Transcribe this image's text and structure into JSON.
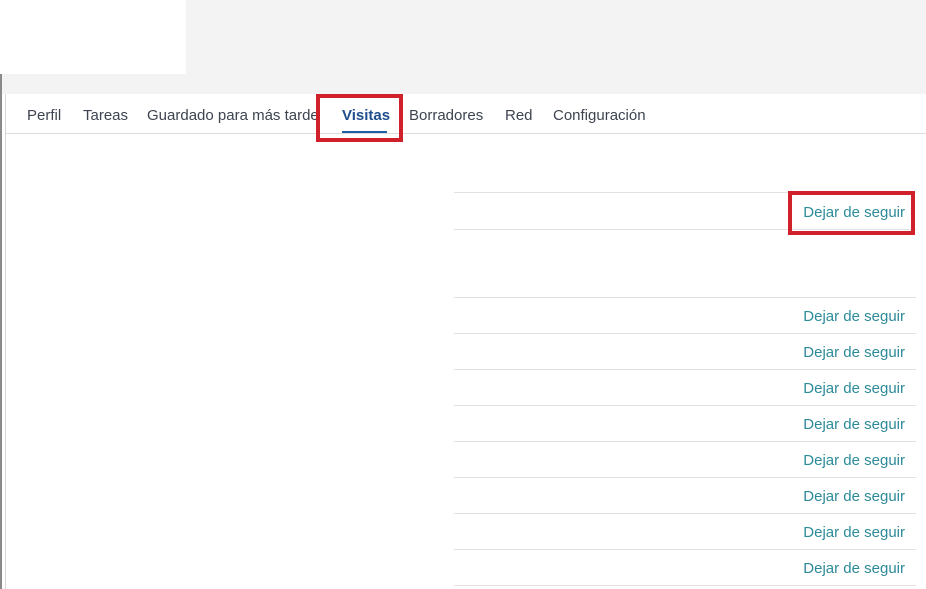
{
  "tabs": [
    {
      "label": "Perfil"
    },
    {
      "label": "Tareas"
    },
    {
      "label": "Guardado para más tarde"
    },
    {
      "label": "Visitas",
      "active": true
    },
    {
      "label": "Borradores"
    },
    {
      "label": "Red"
    },
    {
      "label": "Configuración"
    }
  ],
  "visits": {
    "unfollow_label": "Dejar de seguir",
    "items": [
      {
        "action": "Dejar de seguir"
      },
      {
        "action": "Dejar de seguir"
      },
      {
        "action": "Dejar de seguir"
      },
      {
        "action": "Dejar de seguir"
      },
      {
        "action": "Dejar de seguir"
      },
      {
        "action": "Dejar de seguir"
      },
      {
        "action": "Dejar de seguir"
      },
      {
        "action": "Dejar de seguir"
      },
      {
        "action": "Dejar de seguir"
      }
    ]
  },
  "colors": {
    "active_tab": "#1f4e8c",
    "link": "#2c8a99",
    "highlight": "#d0202a"
  }
}
